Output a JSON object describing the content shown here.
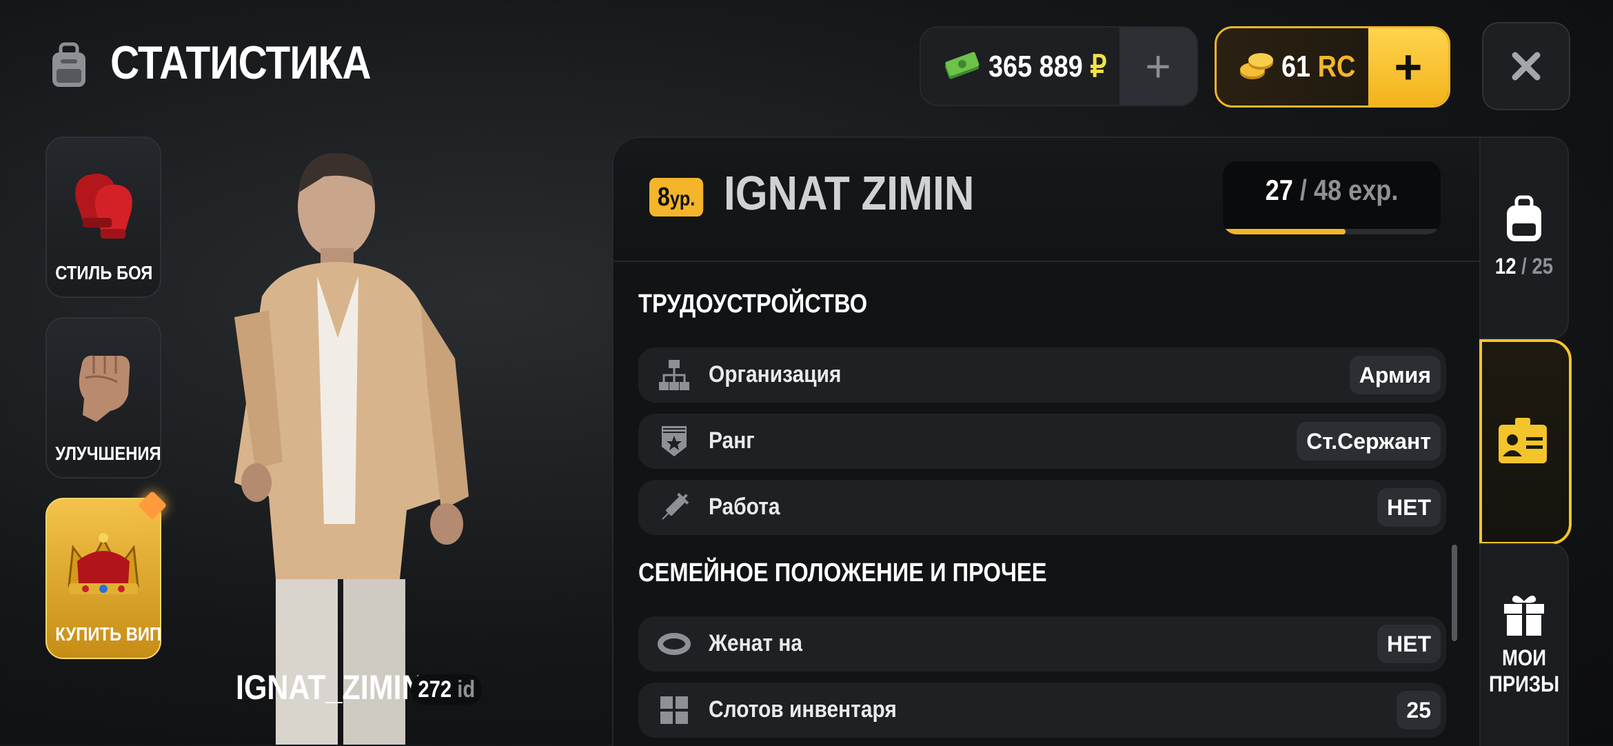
{
  "header": {
    "title": "СТАТИСТИКА",
    "icon": "backpack-icon"
  },
  "currency": {
    "money_amount": "365 889",
    "money_symbol": "₽",
    "rc_amount": "61",
    "rc_label": "RC",
    "add_label": "+"
  },
  "close_icon": "close-icon",
  "side_menu": [
    {
      "label": "СТИЛЬ БОЯ",
      "icon": "boxing-gloves-icon"
    },
    {
      "label": "УЛУЧШЕНИЯ",
      "icon": "fist-icon"
    },
    {
      "label": "КУПИТЬ ВИП",
      "icon": "crown-icon"
    }
  ],
  "character": {
    "name": "IGNAT_ZIMIN",
    "id_value": "272",
    "id_label": "id"
  },
  "profile": {
    "level_value": "8",
    "level_suffix": "ур.",
    "name": "IGNAT ZIMIN",
    "exp_current": "27",
    "exp_sep": "/ 48 exp.",
    "exp_max": 48,
    "exp_progress": 0.5625
  },
  "sections": [
    {
      "title": "ТРУДОУСТРОЙСТВО",
      "rows": [
        {
          "label": "Организация",
          "value": "Армия",
          "icon": "organization-icon"
        },
        {
          "label": "Ранг",
          "value": "Ст.Сержант",
          "icon": "rank-badge-icon"
        },
        {
          "label": "Работа",
          "value": "НЕТ",
          "icon": "syringe-icon"
        }
      ]
    },
    {
      "title": "СЕМЕЙНОЕ ПОЛОЖЕНИЕ И ПРОЧЕЕ",
      "rows": [
        {
          "label": "Женат на",
          "value": "НЕТ",
          "icon": "ring-icon"
        },
        {
          "label": "Слотов инвентаря",
          "value": "25",
          "icon": "inventory-grid-icon"
        }
      ]
    }
  ],
  "right_tabs": {
    "inventory": {
      "count": "12",
      "max": "/ 25",
      "icon": "backpack-icon"
    },
    "id_card": {
      "icon": "id-card-icon"
    },
    "prizes": {
      "line1": "МОИ",
      "line2": "ПРИЗЫ",
      "icon": "gift-icon"
    }
  },
  "colors": {
    "accent": "#f4b52a",
    "money_green": "#f2e24a",
    "panel": "#111315"
  }
}
